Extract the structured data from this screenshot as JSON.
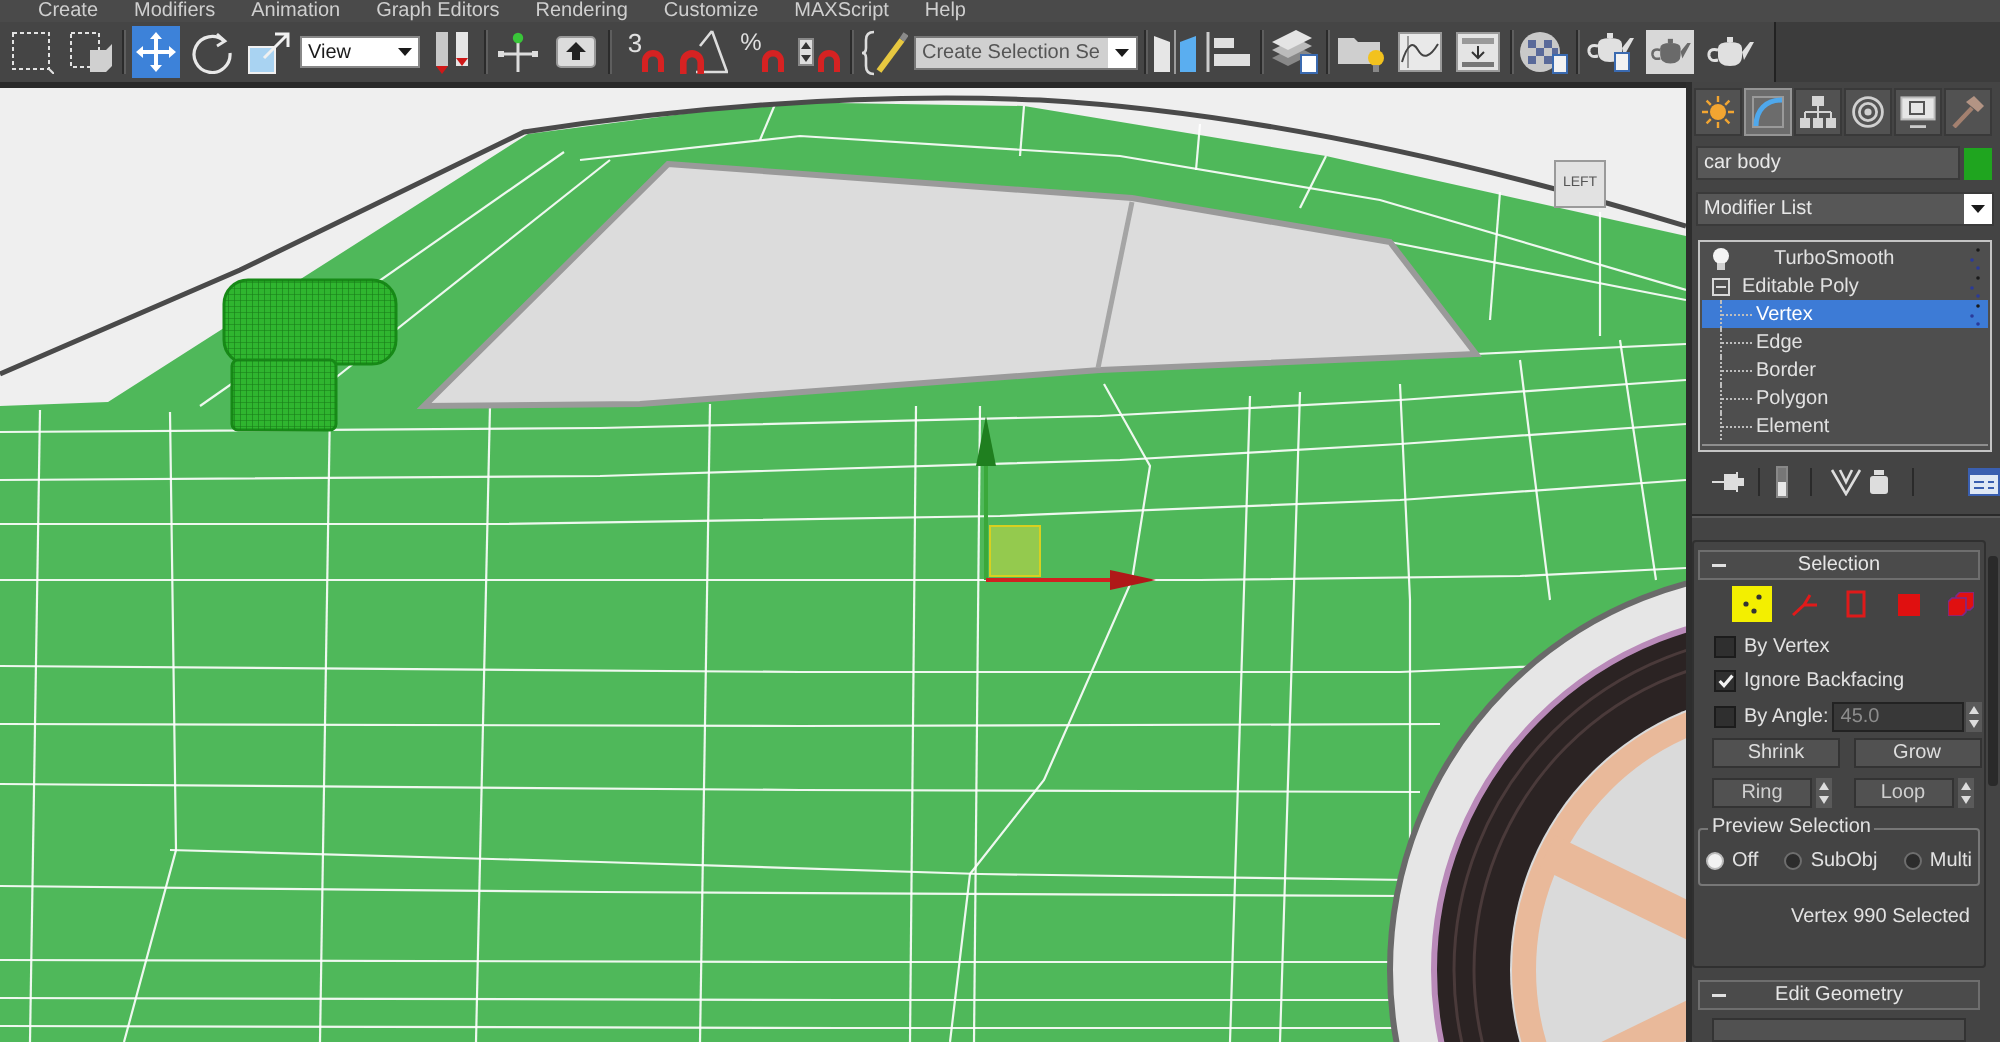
{
  "menu_bar": [
    "Create",
    "Modifiers",
    "Animation",
    "Graph Editors",
    "Rendering",
    "Customize",
    "MAXScript",
    "Help"
  ],
  "main_toolbar": {
    "transform_tools": [
      {
        "selected": false
      },
      {
        "selected": false
      },
      {
        "selected": true
      },
      {
        "selected": false
      },
      {
        "selected": false
      }
    ],
    "reference_coordinate_system": "View",
    "snap_toggle_label": "3",
    "percent_snap_label": "%",
    "named_selection_set": "Create Selection Se"
  },
  "viewport": {
    "view_label": "LEFT"
  },
  "command_panel": {
    "tabs": [
      {
        "selected": false
      },
      {
        "selected": true
      },
      {
        "selected": false
      },
      {
        "selected": false
      },
      {
        "selected": false
      },
      {
        "selected": false
      }
    ],
    "object_name": {
      "value": "car body",
      "color": "#1fa51f"
    },
    "modifier_list": "Modifier List",
    "modifier_stack": [
      {
        "name": "TurboSmooth",
        "kind": "modifier",
        "selected": false
      },
      {
        "name": "Editable Poly",
        "kind": "object",
        "selected": false,
        "expanded": true,
        "children": [
          {
            "name": "Vertex",
            "selected": true
          },
          {
            "name": "Edge",
            "selected": false
          },
          {
            "name": "Border",
            "selected": false
          },
          {
            "name": "Polygon",
            "selected": false
          },
          {
            "name": "Element",
            "selected": false
          }
        ]
      }
    ],
    "selection_rollout": {
      "title": "Selection",
      "expanded": true,
      "subobject_levels": [
        {
          "selected": true
        },
        {
          "selected": false
        },
        {
          "selected": false
        },
        {
          "selected": false
        },
        {
          "selected": false
        }
      ],
      "options": [
        {
          "label": "By Vertex",
          "checked": false
        },
        {
          "label": "Ignore Backfacing",
          "checked": true
        },
        {
          "label": "By Angle:",
          "checked": false,
          "value": "45.0"
        }
      ],
      "buttons": [
        {
          "label": "Shrink",
          "kind": "plain"
        },
        {
          "label": "Grow",
          "kind": "plain"
        },
        {
          "label": "Ring",
          "kind": "spinner"
        },
        {
          "label": "Loop",
          "kind": "spinner"
        }
      ],
      "preview_selection": {
        "title": "Preview Selection",
        "options": [
          {
            "label": "Off",
            "selected": true
          },
          {
            "label": "SubObj",
            "selected": false
          },
          {
            "label": "Multi",
            "selected": false
          }
        ]
      },
      "status": "Vertex 990 Selected"
    },
    "edit_geometry_rollout": {
      "title": "Edit Geometry",
      "expanded": true
    }
  }
}
